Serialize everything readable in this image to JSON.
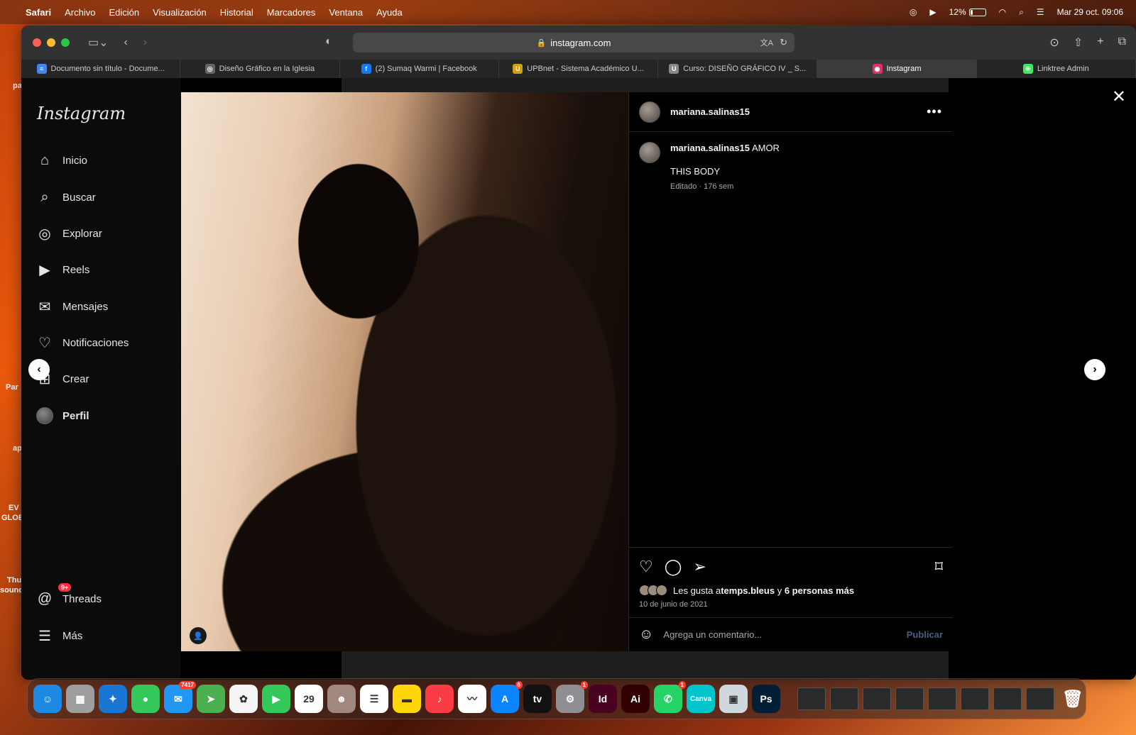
{
  "menubar": {
    "app": "Safari",
    "items": [
      "Archivo",
      "Edición",
      "Visualización",
      "Historial",
      "Marcadores",
      "Ventana",
      "Ayuda"
    ],
    "battery": "12%",
    "datetime": "Mar 29 oct.  09:06"
  },
  "desktop": {
    "labels": [
      "pa",
      "Par",
      "ap",
      "EV",
      "GLOB",
      "Thu",
      "sound"
    ]
  },
  "browser": {
    "url": "instagram.com",
    "tabs": [
      {
        "title": "Documento sin título - Docume...",
        "color": "#4285f4",
        "glyph": "≡"
      },
      {
        "title": "Diseño Gráfico en la Iglesia",
        "color": "#666666",
        "glyph": "◎"
      },
      {
        "title": "(2) Sumaq Warmi | Facebook",
        "color": "#1877f2",
        "glyph": "f"
      },
      {
        "title": "UPBnet - Sistema Académico U...",
        "color": "#d4a017",
        "glyph": "U"
      },
      {
        "title": "Curso: DISEÑO GRÁFICO IV _ S...",
        "color": "#888888",
        "glyph": "U"
      },
      {
        "title": "Instagram",
        "color": "#e1306c",
        "glyph": "◉"
      },
      {
        "title": "Linktree Admin",
        "color": "#43e660",
        "glyph": "✳"
      }
    ]
  },
  "instagram": {
    "logo": "Instagram",
    "nav": [
      {
        "label": "Inicio",
        "icon": "⌂"
      },
      {
        "label": "Buscar",
        "icon": "⌕"
      },
      {
        "label": "Explorar",
        "icon": "◎"
      },
      {
        "label": "Reels",
        "icon": "▶"
      },
      {
        "label": "Mensajes",
        "icon": "✉"
      },
      {
        "label": "Notificaciones",
        "icon": "♡"
      },
      {
        "label": "Crear",
        "icon": "⊞"
      },
      {
        "label": "Perfil",
        "icon": "avatar"
      }
    ],
    "threads": {
      "label": "Threads",
      "badge": "9+"
    },
    "more": {
      "label": "Más"
    }
  },
  "post": {
    "username": "mariana.salinas15",
    "caption_user": "mariana.salinas15",
    "caption": "AMOR",
    "caption_line2": "THIS BODY",
    "meta": "Editado · 176 sem",
    "likes_prefix": "Les gusta a ",
    "likes_user": "temps.bleus",
    "likes_mid": " y ",
    "likes_others": "6 personas más",
    "date": "10 de junio de 2021",
    "comment_placeholder": "Agrega un comentario...",
    "publish": "Publicar"
  },
  "dock": {
    "apps": [
      {
        "name": "Finder",
        "color": "#1e88e5",
        "glyph": "☺"
      },
      {
        "name": "Launchpad",
        "color": "#9e9e9e",
        "glyph": "▦"
      },
      {
        "name": "Safari",
        "color": "#1976d2",
        "glyph": "✦"
      },
      {
        "name": "Messages",
        "color": "#34c759",
        "glyph": "●"
      },
      {
        "name": "Mail",
        "color": "#2196f3",
        "glyph": "✉",
        "badge": "7417"
      },
      {
        "name": "Maps",
        "color": "#4caf50",
        "glyph": "➤"
      },
      {
        "name": "Photos",
        "color": "#f5f5f5",
        "glyph": "✿"
      },
      {
        "name": "FaceTime",
        "color": "#34c759",
        "glyph": "▶"
      },
      {
        "name": "Calendar",
        "color": "#ffffff",
        "glyph": "29"
      },
      {
        "name": "Contacts",
        "color": "#a1887f",
        "glyph": "☻"
      },
      {
        "name": "Reminders",
        "color": "#ffffff",
        "glyph": "☰"
      },
      {
        "name": "Notes",
        "color": "#ffd60a",
        "glyph": "▬"
      },
      {
        "name": "Music",
        "color": "#fc3c44",
        "glyph": "♪"
      },
      {
        "name": "Freeform",
        "color": "#ffffff",
        "glyph": "〰"
      },
      {
        "name": "App Store",
        "color": "#0a84ff",
        "glyph": "A",
        "badge": "6"
      },
      {
        "name": "Apple TV",
        "color": "#111111",
        "glyph": "tv"
      },
      {
        "name": "System Settings",
        "color": "#8e8e93",
        "glyph": "⚙",
        "badge": "1"
      },
      {
        "name": "InDesign",
        "color": "#49021f",
        "glyph": "Id"
      },
      {
        "name": "Illustrator",
        "color": "#330000",
        "glyph": "Ai"
      },
      {
        "name": "WhatsApp",
        "color": "#25d366",
        "glyph": "✆",
        "badge": "1"
      },
      {
        "name": "Canva",
        "color": "#00c4cc",
        "glyph": "Canva"
      },
      {
        "name": "Preview",
        "color": "#cfd8dc",
        "glyph": "▣"
      },
      {
        "name": "Photoshop",
        "color": "#001e36",
        "glyph": "Ps"
      }
    ],
    "thumbnails": 8
  }
}
